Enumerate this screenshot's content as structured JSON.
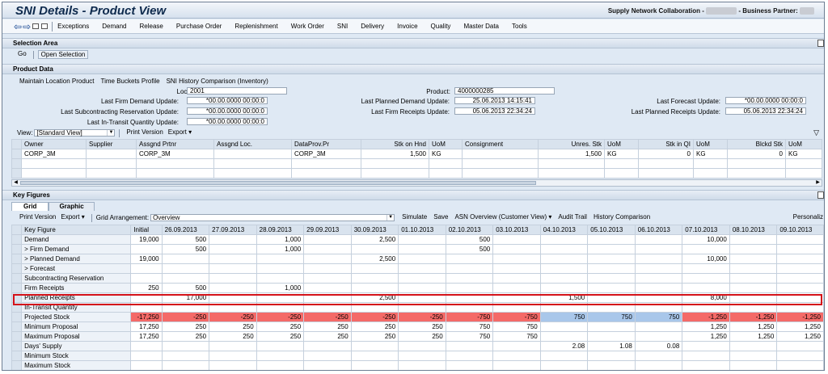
{
  "window": {
    "title": "SNI Details - Product View",
    "header_right_prefix": "Supply Network Collaboration -",
    "header_right_mid": "- Business Partner:"
  },
  "menu": {
    "items": [
      "Exceptions",
      "Demand",
      "Release",
      "Purchase Order",
      "Replenishment",
      "Work Order",
      "SNI",
      "Delivery",
      "Invoice",
      "Quality",
      "Master Data",
      "Tools"
    ]
  },
  "selection_area": {
    "title": "Selection Area",
    "go_label": "Go",
    "open_selection_label": "Open Selection"
  },
  "product_data": {
    "title": "Product Data",
    "toolbar": [
      "Maintain Location Product",
      "Time Buckets Profile",
      "SNI History Comparison (Inventory)"
    ],
    "fields": {
      "location_label": "Location:",
      "location_value": "2001",
      "product_label": "Product:",
      "product_value": "4000000285",
      "last_firm_demand_label": "Last Firm Demand Update:",
      "last_firm_demand_value": "*00.00.0000 00:00:0",
      "last_planned_demand_label": "Last Planned Demand Update:",
      "last_planned_demand_value": "25.06.2013 14:15:41",
      "last_forecast_label": "Last Forecast Update:",
      "last_forecast_value": "*00.00.0000 00:00:0",
      "last_subcontracting_label": "Last Subcontracting Reservation Update:",
      "last_subcontracting_value": "*00.00.0000 00:00:0",
      "last_firm_receipts_label": "Last Firm Receipts Update:",
      "last_firm_receipts_value": "05.06.2013 22:34:24",
      "last_planned_receipts_label": "Last Planned Receipts Update:",
      "last_planned_receipts_value": "05.06.2013 22:34:24",
      "last_in_transit_label": "Last In-Transit Quantity Update:",
      "last_in_transit_value": "*00.00.0000 00:00:0"
    },
    "view_label": "View:",
    "view_value": "[Standard View]",
    "print_version": "Print Version",
    "export": "Export",
    "table": {
      "columns": [
        "Owner",
        "Supplier",
        "Assgnd Prtnr",
        "Assgnd Loc.",
        "DataProv.Pr",
        "Stk on Hnd",
        "UoM",
        "Consignment",
        "Unres. Stk",
        "UoM",
        "Stk in QI",
        "UoM",
        "Blckd Stk",
        "UoM"
      ],
      "rows": [
        [
          "CORP_3M",
          "",
          "CORP_3M",
          "",
          "CORP_3M",
          "1,500",
          "KG",
          "",
          "1,500",
          "KG",
          "0",
          "KG",
          "0",
          "KG"
        ]
      ]
    }
  },
  "key_figures": {
    "title": "Key Figures",
    "tabs": [
      "Grid",
      "Graphic"
    ],
    "toolbar": {
      "print_version": "Print Version",
      "export": "Export",
      "grid_arrangement_label": "Grid Arrangement:",
      "grid_arrangement_value": "Overview",
      "simulate": "Simulate",
      "save": "Save",
      "asn_overview": "ASN Overview (Customer View)",
      "audit_trail": "Audit Trail",
      "history_comparison": "History Comparison",
      "personalize": "Personaliz"
    },
    "columns": [
      "Key Figure",
      "Initial",
      "26.09.2013",
      "27.09.2013",
      "28.09.2013",
      "29.09.2013",
      "30.09.2013",
      "01.10.2013",
      "02.10.2013",
      "03.10.2013",
      "04.10.2013",
      "05.10.2013",
      "06.10.2013",
      "07.10.2013",
      "08.10.2013",
      "09.10.2013"
    ],
    "rows": [
      {
        "name": "Demand",
        "values": [
          "19,000",
          "500",
          "",
          "1,000",
          "",
          "2,500",
          "",
          "500",
          "",
          "",
          "",
          "",
          "10,000",
          "",
          ""
        ]
      },
      {
        "name": "> Firm Demand",
        "values": [
          "",
          "500",
          "",
          "1,000",
          "",
          "",
          "",
          "500",
          "",
          "",
          "",
          "",
          "",
          "",
          ""
        ]
      },
      {
        "name": "> Planned Demand",
        "values": [
          "19,000",
          "",
          "",
          "",
          "",
          "2,500",
          "",
          "",
          "",
          "",
          "",
          "",
          "10,000",
          "",
          ""
        ]
      },
      {
        "name": "> Forecast",
        "values": [
          "",
          "",
          "",
          "",
          "",
          "",
          "",
          "",
          "",
          "",
          "",
          "",
          "",
          "",
          ""
        ]
      },
      {
        "name": "Subcontracting Reservation",
        "values": [
          "",
          "",
          "",
          "",
          "",
          "",
          "",
          "",
          "",
          "",
          "",
          "",
          "",
          "",
          ""
        ]
      },
      {
        "name": "Firm Receipts",
        "values": [
          "250",
          "500",
          "",
          "1,000",
          "",
          "",
          "",
          "",
          "",
          "",
          "",
          "",
          "",
          "",
          ""
        ]
      },
      {
        "name": "Planned Receipts",
        "values": [
          "",
          "17,000",
          "",
          "",
          "",
          "2,500",
          "",
          "",
          "",
          "1,500",
          "",
          "",
          "8,000",
          "",
          ""
        ]
      },
      {
        "name": "In-Transit Quantity",
        "values": [
          "",
          "",
          "",
          "",
          "",
          "",
          "",
          "",
          "",
          "",
          "",
          "",
          "",
          "",
          ""
        ]
      },
      {
        "name": "Projected Stock",
        "values": [
          "-17,250",
          "-250",
          "-250",
          "-250",
          "-250",
          "-250",
          "-250",
          "-750",
          "-750",
          "750",
          "750",
          "750",
          "-1,250",
          "-1,250",
          "-1,250"
        ]
      },
      {
        "name": "Minimum Proposal",
        "values": [
          "17,250",
          "250",
          "250",
          "250",
          "250",
          "250",
          "250",
          "750",
          "750",
          "",
          "",
          "",
          "1,250",
          "1,250",
          "1,250"
        ]
      },
      {
        "name": "Maximum Proposal",
        "values": [
          "17,250",
          "250",
          "250",
          "250",
          "250",
          "250",
          "250",
          "750",
          "750",
          "",
          "",
          "",
          "1,250",
          "1,250",
          "1,250"
        ]
      },
      {
        "name": "Days' Supply",
        "values": [
          "",
          "",
          "",
          "",
          "",
          "",
          "",
          "",
          "",
          "2.08",
          "1.08",
          "0.08",
          "",
          "",
          ""
        ]
      },
      {
        "name": "Minimum Stock",
        "values": [
          "",
          "",
          "",
          "",
          "",
          "",
          "",
          "",
          "",
          "",
          "",
          "",
          "",
          "",
          ""
        ]
      },
      {
        "name": "Maximum Stock",
        "values": [
          "",
          "",
          "",
          "",
          "",
          "",
          "",
          "",
          "",
          "",
          "",
          "",
          "",
          "",
          ""
        ]
      }
    ],
    "highlighted_row": "Planned Receipts"
  },
  "colors": {
    "negative_stock": "#f46a68",
    "positive_stock": "#a9c7ea",
    "highlight_border": "#d4121a"
  }
}
